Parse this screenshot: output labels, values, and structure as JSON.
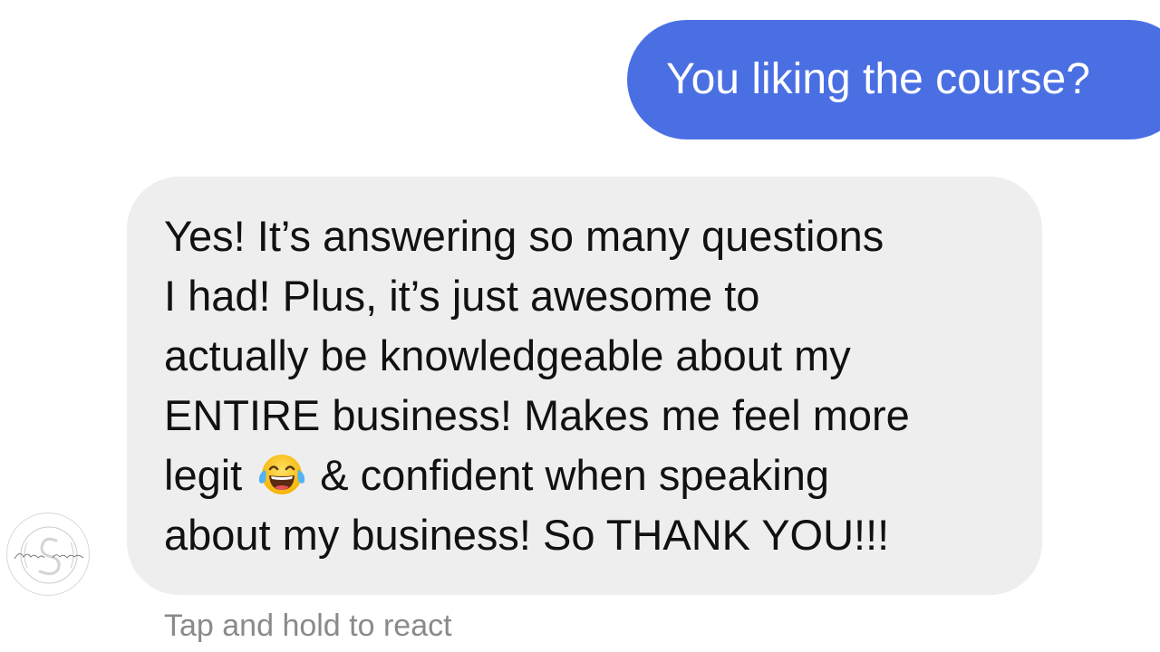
{
  "conversation": {
    "outgoing": {
      "text": "You liking the course?",
      "bubble_color": "#4a6fe3",
      "text_color": "#ffffff"
    },
    "incoming": {
      "lines": [
        "Yes! It’s answering so many questions",
        "I had! Plus, it’s just awesome to",
        "actually be knowledgeable about my",
        "ENTIRE business! Makes me feel more",
        "legit",
        "& confident when speaking",
        "about my business! So THANK YOU!!!"
      ],
      "emoji": "tears-of-joy-emoji",
      "bubble_color": "#eeeeee",
      "text_color": "#111111"
    },
    "sender_avatar": {
      "icon": "logo-watermark-icon",
      "logo_text": "Sparkle by Sophia"
    },
    "hint": "Tap and hold to react"
  }
}
